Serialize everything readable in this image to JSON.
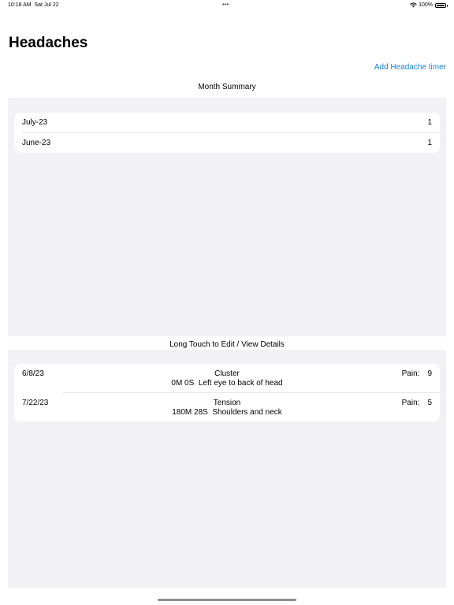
{
  "status_bar": {
    "time": "10:18 AM",
    "date": "Sat Jul 22",
    "dots": "•••",
    "battery": "100%"
  },
  "title": "Headaches",
  "add_button": "Add Headache  timer",
  "month_summary": {
    "header": "Month Summary",
    "rows": [
      {
        "month": "July-23",
        "count": "1"
      },
      {
        "month": "June-23",
        "count": "1"
      }
    ]
  },
  "entries": {
    "header": "Long Touch to Edit / View Details",
    "pain_label": "Pain:",
    "rows": [
      {
        "date": "6/8/23",
        "type": "Cluster",
        "duration": "0M 0S",
        "location": "Left eye to back of head",
        "pain": "9"
      },
      {
        "date": "7/22/23",
        "type": "Tension",
        "duration": "180M 28S",
        "location": "Shoulders and neck",
        "pain": "5"
      }
    ]
  }
}
